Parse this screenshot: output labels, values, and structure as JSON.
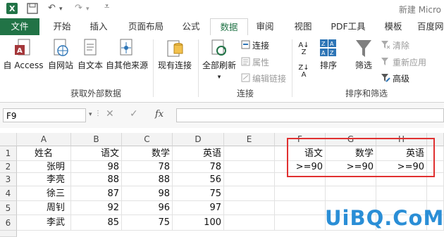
{
  "title_bar": {
    "title": "新建 Micro"
  },
  "tabs": [
    "文件",
    "开始",
    "插入",
    "页面布局",
    "公式",
    "数据",
    "审阅",
    "视图",
    "PDF工具",
    "模板",
    "百度网"
  ],
  "active_tab": "数据",
  "ribbon": {
    "get_external": {
      "access": "自 Access",
      "web": "自网站",
      "text": "自文本",
      "other": "自其他来源",
      "existing": "现有连接",
      "group_label": "获取外部数据"
    },
    "connections": {
      "refresh_all": "全部刷新",
      "connections": "连接",
      "properties": "属性",
      "edit_links": "编辑链接",
      "group_label": "连接"
    },
    "sort_filter": {
      "sort": "排序",
      "filter": "筛选",
      "clear": "清除",
      "reapply": "重新应用",
      "advanced": "高级",
      "group_label": "排序和筛选"
    }
  },
  "formula_bar": {
    "name_box": "F9",
    "fx": "fx"
  },
  "sheet": {
    "columns": [
      "A",
      "B",
      "C",
      "D",
      "E",
      "F",
      "G",
      "H"
    ],
    "rows": [
      "1",
      "2",
      "3",
      "4",
      "5",
      "6"
    ],
    "cells": {
      "A1": "姓名",
      "B1": "语文",
      "C1": "数学",
      "D1": "英语",
      "A2": "张明",
      "B2": "98",
      "C2": "78",
      "D2": "78",
      "A3": "李亮",
      "B3": "88",
      "C3": "88",
      "D3": "56",
      "A4": "徐三",
      "B4": "87",
      "C4": "98",
      "D4": "75",
      "A5": "周钊",
      "B5": "92",
      "C5": "96",
      "D5": "97",
      "A6": "李武",
      "B6": "85",
      "C6": "75",
      "D6": "100",
      "F1": "语文",
      "G1": "数学",
      "H1": "英语",
      "F2": ">=90",
      "G2": ">=90",
      "H2": ">=90"
    }
  },
  "watermark": "UiBQ.CoM",
  "colors": {
    "accent": "#217346",
    "highlight_box": "#e03030"
  }
}
